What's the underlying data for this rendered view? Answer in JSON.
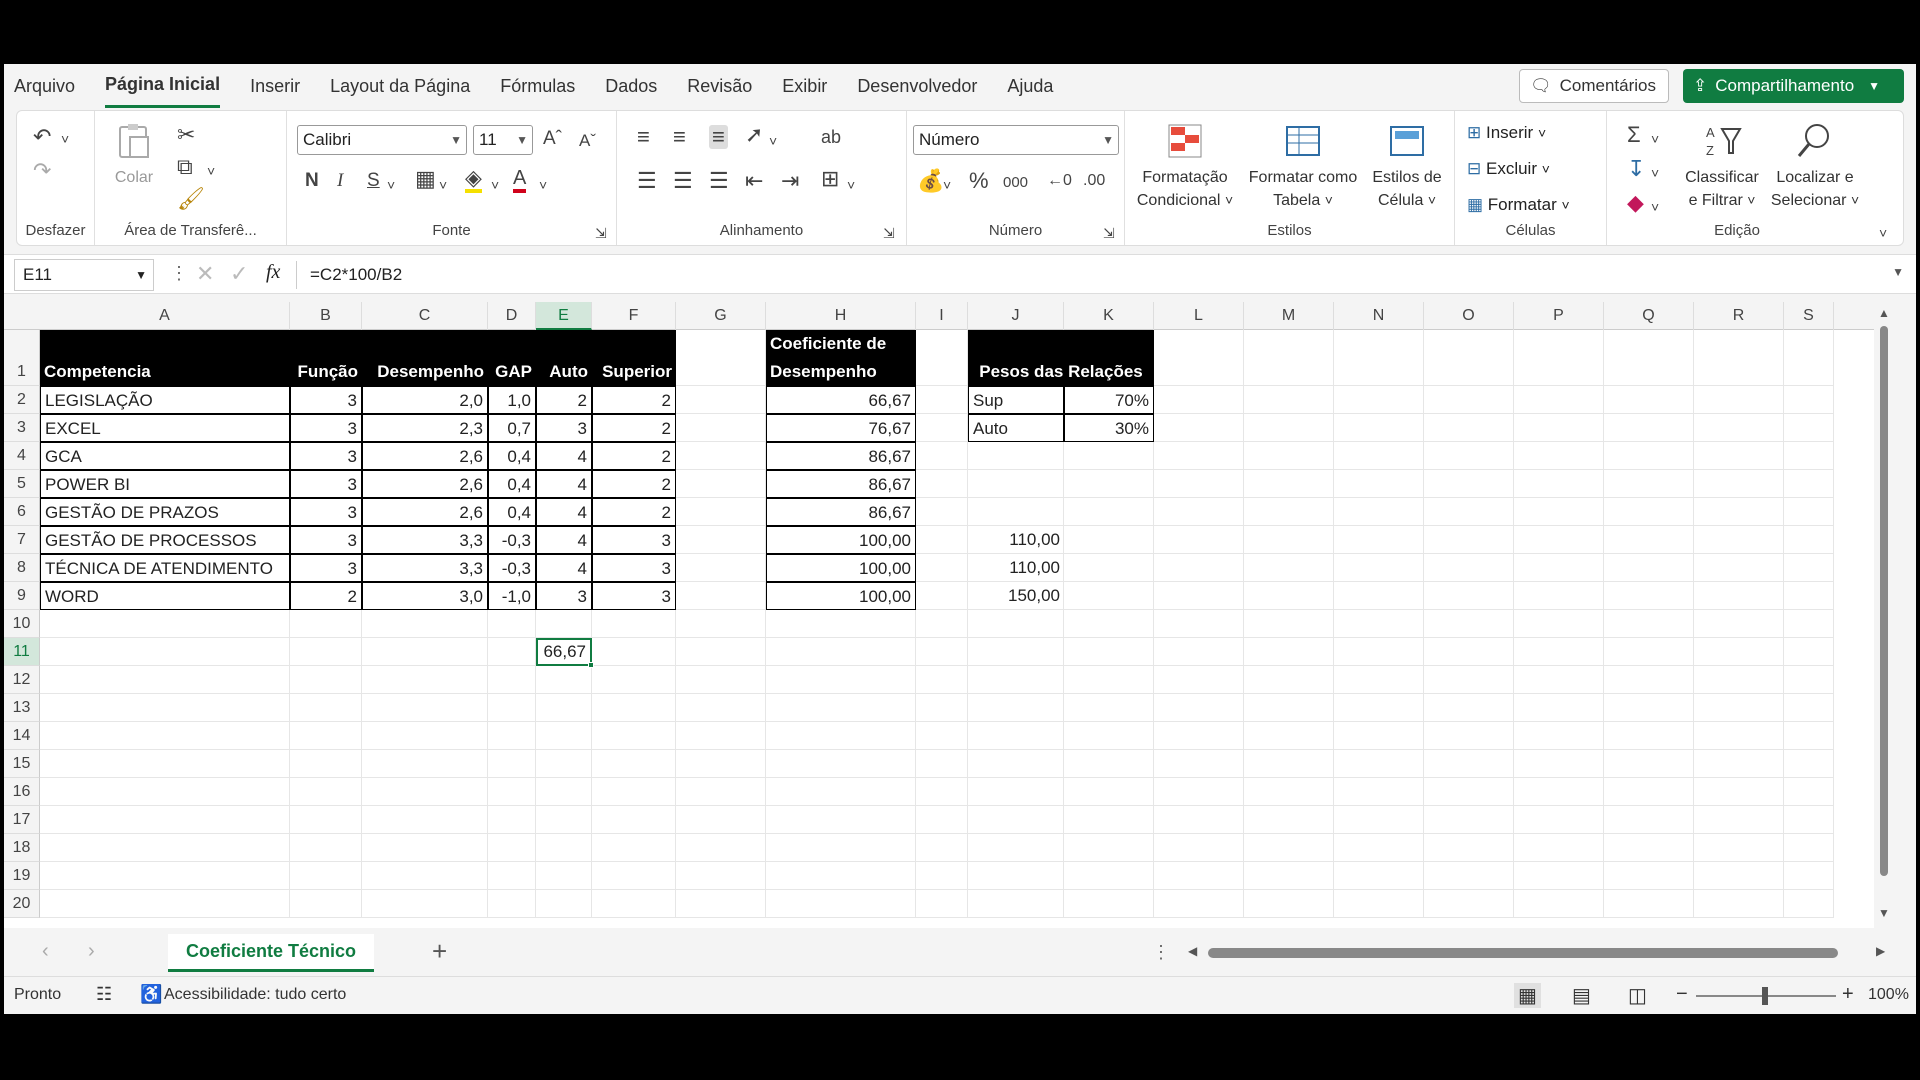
{
  "menu": {
    "tabs": [
      "Arquivo",
      "Página Inicial",
      "Inserir",
      "Layout da Página",
      "Fórmulas",
      "Dados",
      "Revisão",
      "Exibir",
      "Desenvolvedor",
      "Ajuda"
    ],
    "comments": "Comentários",
    "share": "Compartilhamento"
  },
  "ribbon": {
    "undo_group": "Desfazer",
    "clipboard": {
      "paste": "Colar",
      "group": "Área de Transferê..."
    },
    "font": {
      "name": "Calibri",
      "size": "11",
      "bold": "N",
      "italic": "I",
      "underline": "S",
      "group": "Fonte"
    },
    "alignment": {
      "group": "Alinhamento"
    },
    "number": {
      "format": "Número",
      "percent": "%",
      "thousands": "000",
      "group": "Número"
    },
    "styles": {
      "cond1": "Formatação",
      "cond2": "Condicional",
      "table1": "Formatar como",
      "table2": "Tabela",
      "cell1": "Estilos de",
      "cell2": "Célula",
      "group": "Estilos"
    },
    "cells": {
      "insert": "Inserir",
      "delete": "Excluir",
      "format": "Formatar",
      "group": "Células"
    },
    "editing": {
      "sort1": "Classificar",
      "sort2": "e Filtrar",
      "find1": "Localizar e",
      "find2": "Selecionar",
      "group": "Edição"
    }
  },
  "formula_bar": {
    "name_box": "E11",
    "fx": "fx",
    "formula": "=C2*100/B2"
  },
  "columns": [
    "A",
    "B",
    "C",
    "D",
    "E",
    "F",
    "G",
    "H",
    "I",
    "J",
    "K",
    "L",
    "M",
    "N",
    "O",
    "P",
    "Q",
    "R",
    "S"
  ],
  "rows": [
    "1",
    "2",
    "3",
    "4",
    "5",
    "6",
    "7",
    "8",
    "9",
    "10",
    "11",
    "12",
    "13",
    "14",
    "15",
    "16",
    "17",
    "18",
    "19",
    "20"
  ],
  "table": {
    "headers": [
      "Competencia",
      "Função",
      "Desempenho",
      "GAP",
      "Auto",
      "Superior"
    ],
    "rows": [
      [
        "LEGISLAÇÃO",
        "3",
        "2,0",
        "1,0",
        "2",
        "2"
      ],
      [
        "EXCEL",
        "3",
        "2,3",
        "0,7",
        "3",
        "2"
      ],
      [
        "GCA",
        "3",
        "2,6",
        "0,4",
        "4",
        "2"
      ],
      [
        "POWER BI",
        "3",
        "2,6",
        "0,4",
        "4",
        "2"
      ],
      [
        "GESTÃO DE PRAZOS",
        "3",
        "2,6",
        "0,4",
        "4",
        "2"
      ],
      [
        "GESTÃO DE PROCESSOS",
        "3",
        "3,3",
        "-0,3",
        "4",
        "3"
      ],
      [
        "TÉCNICA DE ATENDIMENTO",
        "3",
        "3,3",
        "-0,3",
        "4",
        "3"
      ],
      [
        "WORD",
        "2",
        "3,0",
        "-1,0",
        "3",
        "3"
      ]
    ]
  },
  "coef": {
    "header1": "Coeficiente de",
    "header2": "Desempenho",
    "values": [
      "66,67",
      "76,67",
      "86,67",
      "86,67",
      "86,67",
      "100,00",
      "100,00",
      "100,00"
    ]
  },
  "weights": {
    "header": "Pesos das Relações",
    "rows": [
      [
        "Sup",
        "70%"
      ],
      [
        "Auto",
        "30%"
      ]
    ]
  },
  "j_values": [
    "110,00",
    "110,00",
    "150,00"
  ],
  "active_value": "66,67",
  "sheet_tab": "Coeficiente Técnico",
  "status": {
    "ready": "Pronto",
    "accessibility": "Acessibilidade: tudo certo",
    "zoom": "100%"
  },
  "colors": {
    "accent": "#107c41",
    "header_bg": "#000000"
  }
}
